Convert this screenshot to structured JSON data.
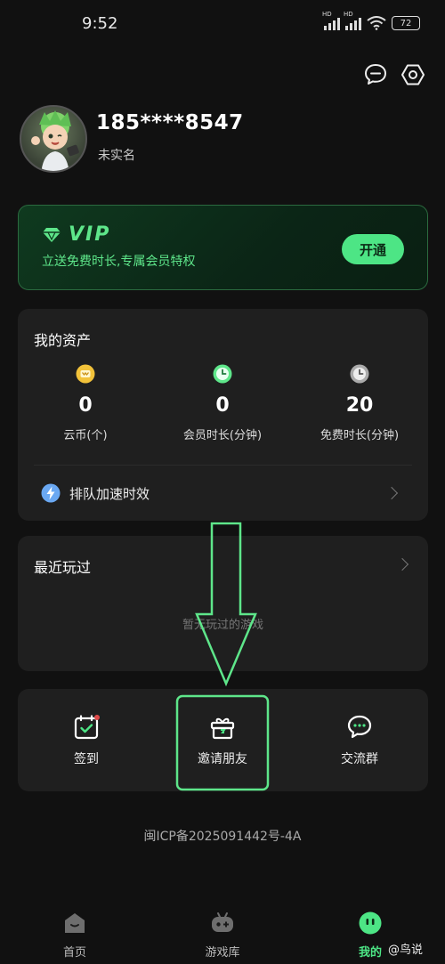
{
  "status_bar": {
    "time": "9:52",
    "battery": "72",
    "hd": "HD"
  },
  "profile": {
    "phone": "185****8547",
    "realname_status": "未实名"
  },
  "vip": {
    "label": "VIP",
    "subtitle": "立送免费时长,专属会员特权",
    "button": "开通"
  },
  "assets": {
    "title": "我的资产",
    "items": [
      {
        "value": "0",
        "label": "云币(个)",
        "icon": "coin-icon",
        "color": "#f2c23a"
      },
      {
        "value": "0",
        "label": "会员时长(分钟)",
        "icon": "clock-icon",
        "color": "#5ee68a"
      },
      {
        "value": "20",
        "label": "免费时长(分钟)",
        "icon": "clock-icon",
        "color": "#aaaaaa"
      }
    ],
    "queue_label": "排队加速时效"
  },
  "recent": {
    "title": "最近玩过",
    "empty": "暂无玩过的游戏"
  },
  "quick_actions": [
    {
      "label": "签到",
      "icon": "checkin-calendar-icon"
    },
    {
      "label": "邀请朋友",
      "icon": "gift-icon"
    },
    {
      "label": "交流群",
      "icon": "chat-bubble-icon"
    }
  ],
  "icp": "闽ICP备2025091442号-4A",
  "tabs": [
    {
      "label": "首页",
      "icon": "home-icon",
      "active": false
    },
    {
      "label": "游戏库",
      "icon": "gamepad-icon",
      "active": false
    },
    {
      "label": "我的",
      "icon": "profile-face-icon",
      "active": true
    }
  ],
  "watermark": "@鸟说",
  "colors": {
    "accent": "#4de585",
    "background": "#111111",
    "card": "#1f1f1f"
  }
}
